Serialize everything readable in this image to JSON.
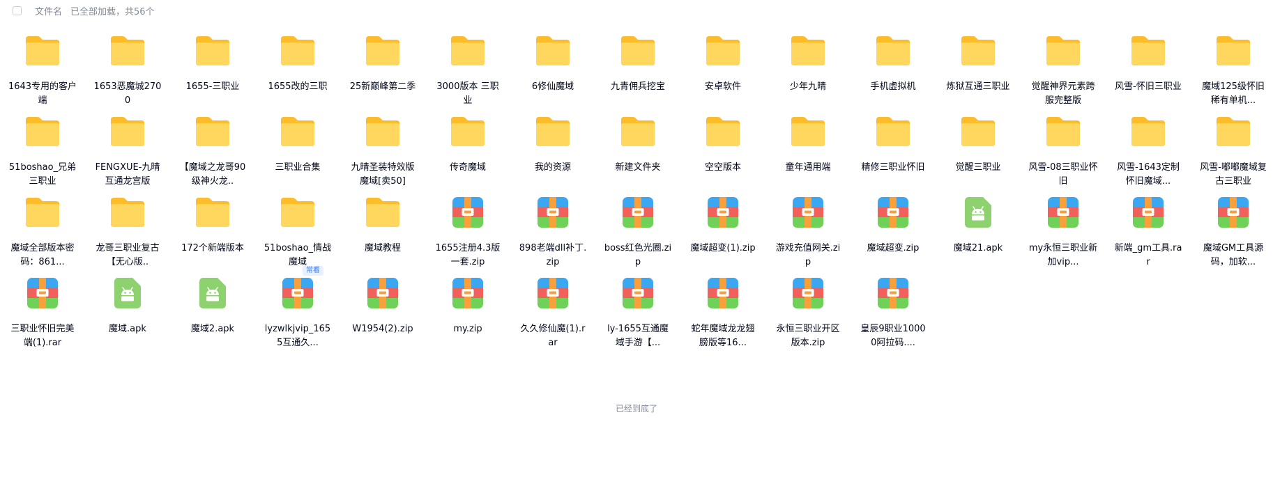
{
  "header": {
    "column_label": "文件名",
    "status": "已全部加载，共56个"
  },
  "footer": {
    "end_text": "已经到底了"
  },
  "files": [
    {
      "name": "1643专用的客户端",
      "type": "folder"
    },
    {
      "name": "1653恶魔城2700",
      "type": "folder"
    },
    {
      "name": "1655-三职业",
      "type": "folder"
    },
    {
      "name": "1655改的三职",
      "type": "folder"
    },
    {
      "name": "25新巅峰第二季",
      "type": "folder"
    },
    {
      "name": "3000版本 三职业",
      "type": "folder"
    },
    {
      "name": "6修仙魔域",
      "type": "folder"
    },
    {
      "name": "九青佣兵挖宝",
      "type": "folder"
    },
    {
      "name": "安卓软件",
      "type": "folder"
    },
    {
      "name": "少年九晴",
      "type": "folder"
    },
    {
      "name": "手机虚拟机",
      "type": "folder"
    },
    {
      "name": "炼狱互通三职业",
      "type": "folder"
    },
    {
      "name": "觉醒神界元素跨服完整版",
      "type": "folder"
    },
    {
      "name": "风雪-怀旧三职业",
      "type": "folder"
    },
    {
      "name": "魔域125级怀旧稀有单机...",
      "type": "folder"
    },
    {
      "name": "51boshao_兄弟三职业",
      "type": "folder"
    },
    {
      "name": "FENGXUE-九晴互通龙宫版",
      "type": "folder"
    },
    {
      "name": "【魔域之龙哥90级神火龙..",
      "type": "folder"
    },
    {
      "name": "三职业合集",
      "type": "folder"
    },
    {
      "name": "九晴圣装特效版魔域[卖50]",
      "type": "folder"
    },
    {
      "name": "传奇魔域",
      "type": "folder"
    },
    {
      "name": "我的资源",
      "type": "folder"
    },
    {
      "name": "新建文件夹",
      "type": "folder"
    },
    {
      "name": "空空版本",
      "type": "folder"
    },
    {
      "name": "童年通用端",
      "type": "folder"
    },
    {
      "name": "精修三职业怀旧",
      "type": "folder"
    },
    {
      "name": "觉醒三职业",
      "type": "folder"
    },
    {
      "name": "风雪-08三职业怀旧",
      "type": "folder"
    },
    {
      "name": "风雪-1643定制怀旧魔域...",
      "type": "folder"
    },
    {
      "name": "风雪-嘟嘟魔域复古三职业",
      "type": "folder"
    },
    {
      "name": "魔域全部版本密码：861...",
      "type": "folder"
    },
    {
      "name": "龙哥三职业复古【无心版..",
      "type": "folder"
    },
    {
      "name": "172个新端版本",
      "type": "folder"
    },
    {
      "name": "51boshao_情战魔域",
      "type": "folder"
    },
    {
      "name": "魔域教程",
      "type": "folder"
    },
    {
      "name": "1655注册4.3版一套.zip",
      "type": "archive"
    },
    {
      "name": "898老端dll补丁.zip",
      "type": "archive"
    },
    {
      "name": "boss红色光圈.zip",
      "type": "archive"
    },
    {
      "name": "魔域超变(1).zip",
      "type": "archive"
    },
    {
      "name": "游戏充值网关.zip",
      "type": "archive"
    },
    {
      "name": "魔域超变.zip",
      "type": "archive"
    },
    {
      "name": "魔域21.apk",
      "type": "apk"
    },
    {
      "name": "my永恒三职业新加vip...",
      "type": "archive"
    },
    {
      "name": "新端_gm工具.rar",
      "type": "archive"
    },
    {
      "name": "魔域GM工具源码，加软...",
      "type": "archive"
    },
    {
      "name": "三职业怀旧完美端(1).rar",
      "type": "archive"
    },
    {
      "name": "魔域.apk",
      "type": "apk"
    },
    {
      "name": "魔域2.apk",
      "type": "apk"
    },
    {
      "name": "lyzwlkjvip_1655互通久...",
      "type": "archive",
      "badge": "常看"
    },
    {
      "name": "W1954(2).zip",
      "type": "archive"
    },
    {
      "name": "my.zip",
      "type": "archive"
    },
    {
      "name": "久久修仙魔(1).rar",
      "type": "archive"
    },
    {
      "name": "ly-1655互通魔域手游【...",
      "type": "archive"
    },
    {
      "name": "蛇年魔域龙龙翅膀版等16...",
      "type": "archive"
    },
    {
      "name": "永恒三职业开区版本.zip",
      "type": "archive"
    },
    {
      "name": "皇辰9职业10000阿拉码....",
      "type": "archive"
    }
  ],
  "colors": {
    "folder_back": "#fdbd2a",
    "folder_front": "#ffd75e",
    "archive_blue": "#3ba7f0",
    "archive_red": "#f2605c",
    "archive_green": "#6fd157",
    "archive_orange": "#f7a03c",
    "apk_green": "#8ed16f"
  }
}
